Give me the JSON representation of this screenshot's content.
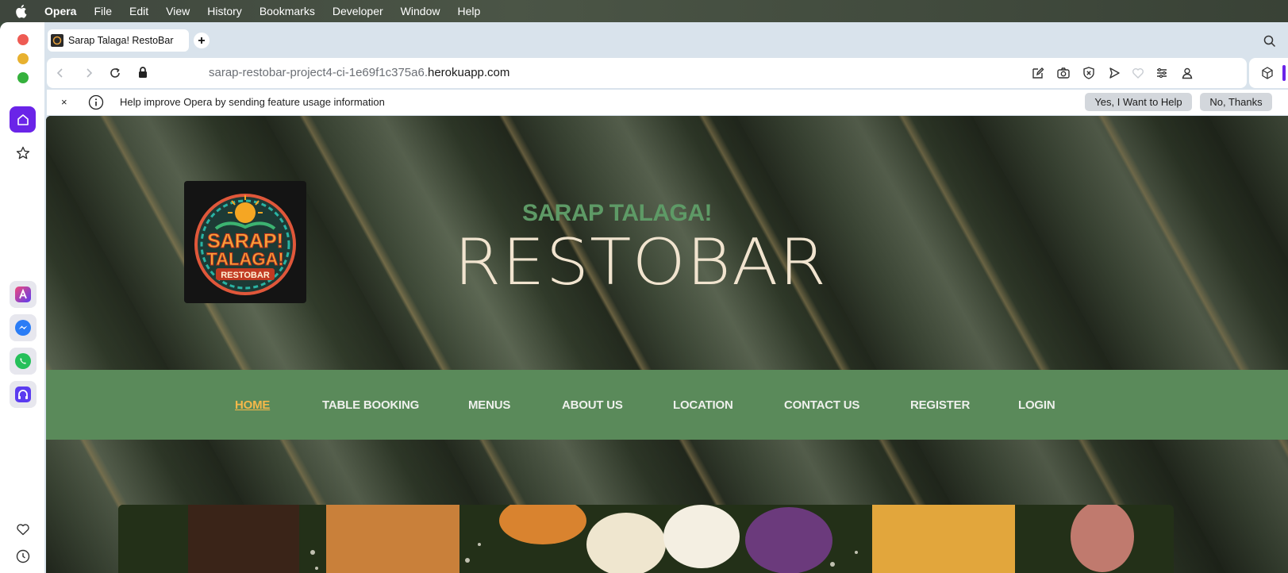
{
  "menubar": {
    "items": [
      "Opera",
      "File",
      "Edit",
      "View",
      "History",
      "Bookmarks",
      "Developer",
      "Window",
      "Help"
    ]
  },
  "tab": {
    "title": "Sarap Talaga! RestoBar"
  },
  "address": {
    "url_prefix": "sarap-restobar-project4-ci-1e69f1c375a6.",
    "url_host": "herokuapp.com"
  },
  "infobar": {
    "close": "×",
    "text": "Help improve Opera by sending feature usage information",
    "yes_label": "Yes, I Want to Help",
    "no_label": "No, Thanks"
  },
  "site": {
    "logo_text_1": "SARAP!",
    "logo_text_2": "TALAGA!",
    "logo_text_3": "RESTOBAR",
    "brand_top": "SARAP TALAGA!",
    "brand_main": "RESTOBAR",
    "nav": [
      "HOME",
      "TABLE BOOKING",
      "MENUS",
      "ABOUT US",
      "LOCATION",
      "CONTACT US",
      "REGISTER",
      "LOGIN"
    ],
    "active_nav": "HOME"
  },
  "colors": {
    "accent": "#6a24e8",
    "nav_bg": "#5a8a5a",
    "nav_active": "#f5b84a",
    "brand_green": "#5e9a66"
  }
}
